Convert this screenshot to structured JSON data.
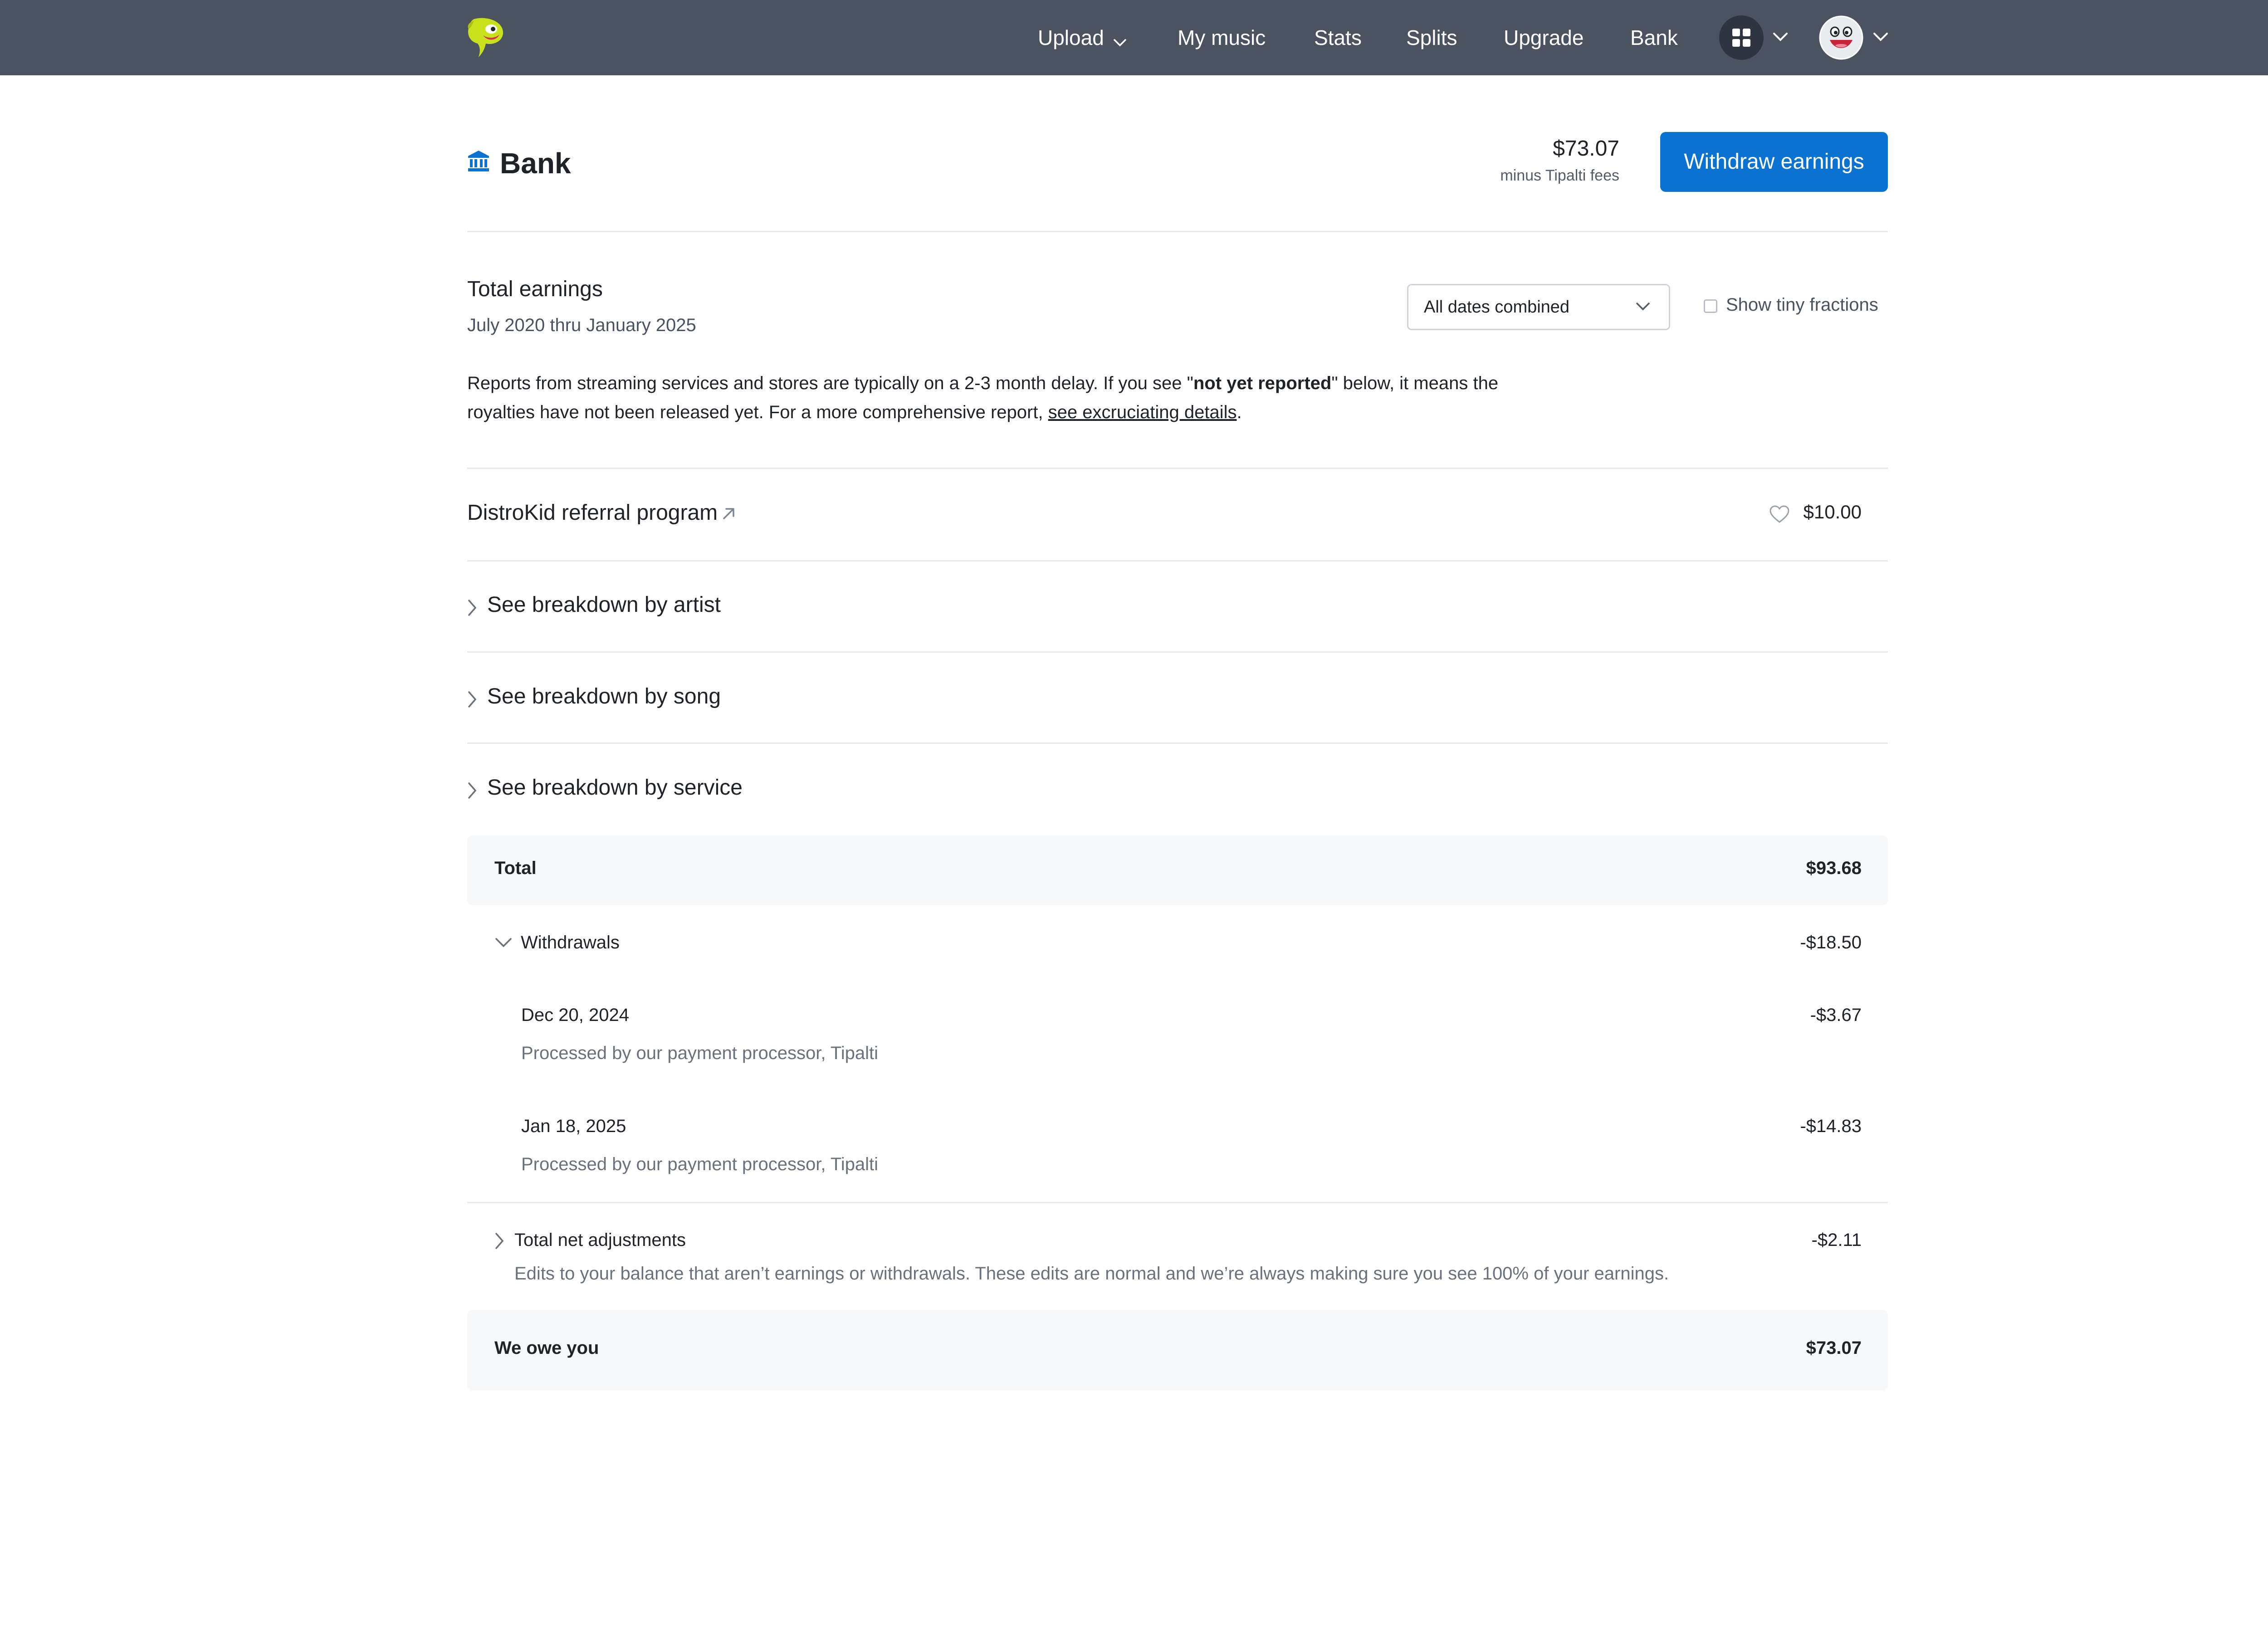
{
  "nav": {
    "items": [
      {
        "label": "Upload",
        "has_dropdown": true
      },
      {
        "label": "My music"
      },
      {
        "label": "Stats"
      },
      {
        "label": "Splits"
      },
      {
        "label": "Upgrade"
      },
      {
        "label": "Bank"
      }
    ],
    "icons": [
      "distrokid-logo-icon",
      "apps-grid-icon",
      "chevron-down-icon",
      "user-avatar-icon"
    ]
  },
  "bank": {
    "title": "Bank",
    "icon": "bank-building-icon",
    "balance": "$73.07",
    "balance_note": "minus Tipalti fees",
    "withdraw_label": "Withdraw earnings",
    "accent_color": "#0a72d1"
  },
  "earnings": {
    "title": "Total earnings",
    "range": "July 2020 thru January 2025",
    "date_filter": "All dates combined",
    "tiny_fractions_label": "Show tiny fractions",
    "tiny_fractions_checked": false,
    "report_text_1": "Reports from streaming services and stores are typically on a 2-3 month delay. If you see \"",
    "report_bold": "not yet reported",
    "report_text_2": "\" below, it means the royalties have not been released yet. For a more comprehensive report, ",
    "report_link": "see excruciating details",
    "report_text_3": "."
  },
  "referral": {
    "label": "DistroKid referral program",
    "amount": "$10.00"
  },
  "breakdowns": [
    {
      "label": "See breakdown by artist"
    },
    {
      "label": "See breakdown by song"
    },
    {
      "label": "See breakdown by service"
    }
  ],
  "summary": {
    "total_label": "Total",
    "total_amount": "$93.68",
    "withdrawals_label": "Withdrawals",
    "withdrawals_amount": "-$18.50",
    "withdrawals": [
      {
        "date": "Dec 20, 2024",
        "note": "Processed by our payment processor, Tipalti",
        "amount": "-$3.67"
      },
      {
        "date": "Jan 18, 2025",
        "note": "Processed by our payment processor, Tipalti",
        "amount": "-$14.83"
      }
    ],
    "adjustments_label": "Total net adjustments",
    "adjustments_amount": "-$2.11",
    "adjustments_note": "Edits to your balance that aren’t earnings or withdrawals. These edits are normal and we’re always making sure you see 100% of your earnings.",
    "owe_label": "We owe you",
    "owe_amount": "$73.07"
  }
}
